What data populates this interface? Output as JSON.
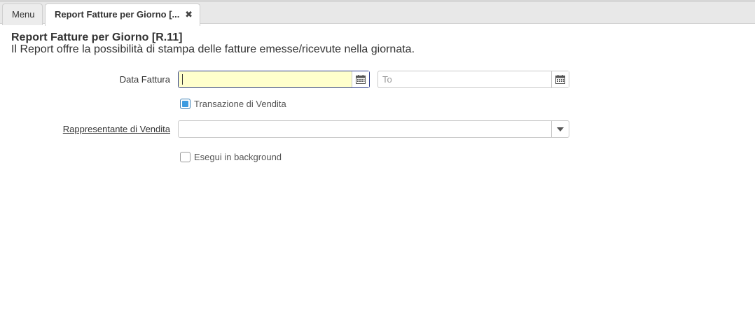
{
  "tabs": [
    {
      "label": "Menu"
    },
    {
      "label": "Report Fatture per Giorno [...",
      "close_icon": "✖"
    }
  ],
  "header": {
    "title": "Report Fatture per Giorno [R.11]",
    "subtitle": "Il Report offre la possibilità di stampa delle fatture emesse/ricevute nella giornata."
  },
  "form": {
    "data_fattura": {
      "label": "Data Fattura",
      "from_value": "",
      "to_placeholder": "To",
      "calendar_icon": "calendar-icon"
    },
    "transazione_vendita": {
      "label": "Transazione di Vendita",
      "checked": true
    },
    "rappresentante": {
      "label": "Rappresentante di Vendita",
      "value": "",
      "dropdown_icon": "chevron-down-icon"
    },
    "background": {
      "label": "Esegui in background",
      "checked": false
    }
  },
  "colors": {
    "focus_fill": "#ffffcc",
    "focus_border": "#2b3a8a",
    "check_accent": "#3c9be0"
  }
}
